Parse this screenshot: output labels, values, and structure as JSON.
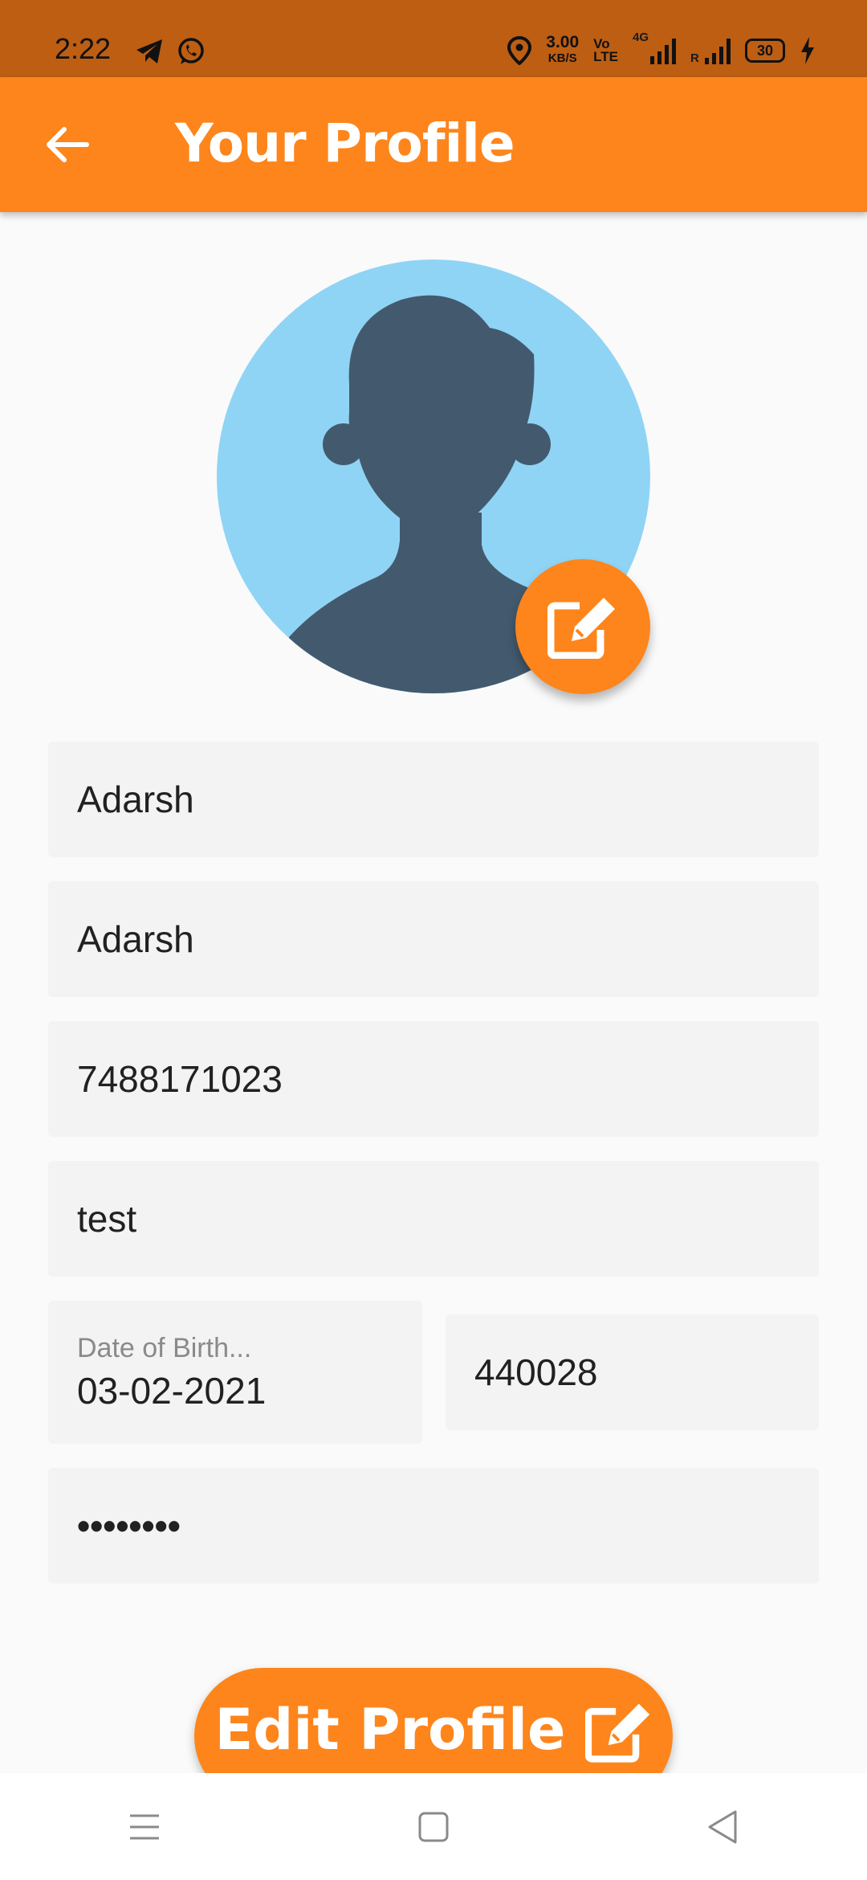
{
  "status_bar": {
    "time": "2:22",
    "speed_value": "3.00",
    "speed_unit": "KB/S",
    "volte_top": "Vo",
    "volte_bottom": "LTE",
    "network": "4G",
    "roaming": "R",
    "battery": "30",
    "apps": [
      "telegram-icon",
      "whatsapp-icon"
    ]
  },
  "app_bar": {
    "title": "Your Profile"
  },
  "form": {
    "first_name": "Adarsh",
    "last_name": "Adarsh",
    "phone": "7488171023",
    "address": "test",
    "dob_label": "Date of Birth...",
    "dob_value": "03-02-2021",
    "pincode": "440028",
    "password": "••••••••"
  },
  "edit_button": {
    "label": "Edit Profile"
  },
  "colors": {
    "primary": "#fd851b",
    "status_bar": "#bd5e13",
    "avatar_bg": "#8fd4f5",
    "avatar_fg": "#435a6e",
    "field_bg": "#f3f3f3"
  }
}
